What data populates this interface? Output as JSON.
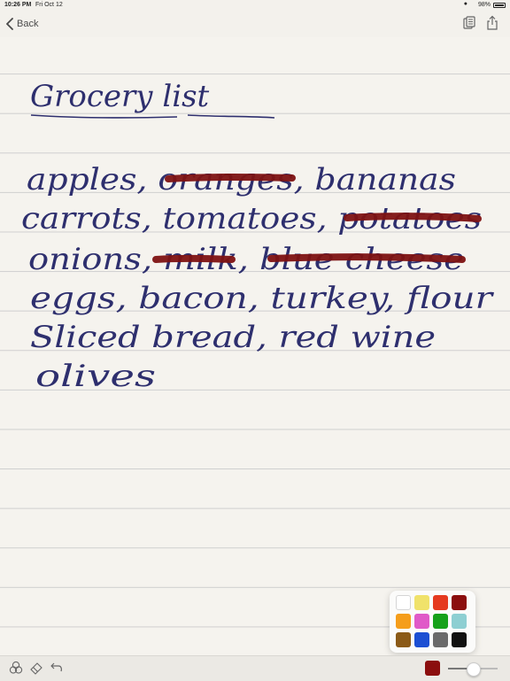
{
  "status_bar": {
    "time": "10:26 PM",
    "date": "Fri Oct 12",
    "battery": "98%"
  },
  "nav": {
    "back_label": "Back"
  },
  "note": {
    "title": "Grocery list",
    "lines": [
      "apples, oranges, bananas",
      "carrots, tomatoes, potatoes",
      "onions, milk, blue cheese",
      "eggs, bacon, turkey, flour",
      "Sliced bread, red wine",
      "olives"
    ],
    "strikethrough_items": [
      "oranges",
      "potatoes",
      "milk",
      "blue cheese"
    ],
    "ink_color": "#2e2f6e",
    "strike_color": "#7e1212"
  },
  "toolbar": {
    "current_color": "#8b0e0e",
    "stroke_width_fraction": 0.5
  },
  "color_picker": {
    "swatches": [
      "#ffffff",
      "#f0e26a",
      "#e5391f",
      "#8b0e0e",
      "#f59e1b",
      "#e05ac8",
      "#16a11a",
      "#8ecfd2",
      "#8b5a17",
      "#1c4fd3",
      "#6a6a6a",
      "#111111"
    ]
  },
  "icons": {
    "back": "chevron-left-icon",
    "copy": "copy-icon",
    "share": "share-icon",
    "shapes": "shapes-icon",
    "eraser": "eraser-icon",
    "undo": "undo-icon"
  }
}
